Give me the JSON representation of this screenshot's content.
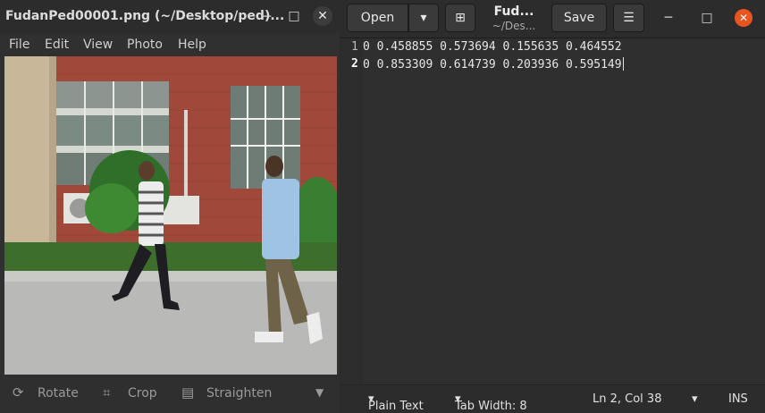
{
  "viewer": {
    "title": "FudanPed00001.png (~/Desktop/ped)...",
    "menu": [
      "File",
      "Edit",
      "View",
      "Photo",
      "Help"
    ],
    "tools": {
      "rotate": "Rotate",
      "crop": "Crop",
      "straighten": "Straighten"
    }
  },
  "editor": {
    "open_label": "Open",
    "save_label": "Save",
    "title": "Fud...",
    "subtitle": "~/Des...",
    "lines": [
      {
        "number": "1",
        "text": "0 0.458855 0.573694 0.155635 0.464552"
      },
      {
        "number": "2",
        "text": "0 0.853309 0.614739 0.203936 0.595149"
      }
    ],
    "status": {
      "language": "Plain Text",
      "tab_width": "Tab Width: 8",
      "position": "Ln 2, Col 38",
      "mode": "INS"
    }
  },
  "colors": {
    "close_accent": "#e95420",
    "window_bg": "#2f2f2f"
  }
}
